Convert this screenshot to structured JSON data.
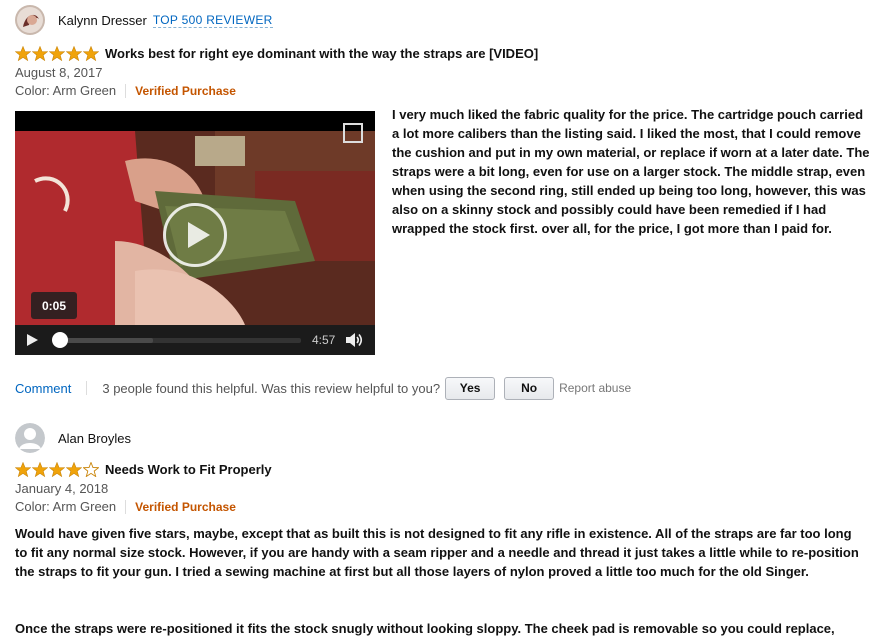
{
  "review1": {
    "reviewer": "Kalynn Dresser",
    "badge": "TOP 500 REVIEWER",
    "rating": 5,
    "title": "Works best for right eye dominant with the way the straps are [VIDEO]",
    "date": "August 8, 2017",
    "color": "Color: Arm Green",
    "verified": "Verified Purchase",
    "video": {
      "tooltip_time": "0:05",
      "duration": "4:57",
      "progress": 0.02,
      "buffered": 0.4
    },
    "body": " I very much liked the fabric quality for the price. The cartridge pouch carried a lot more calibers than the listing said. I liked the most, that I could remove the cushion and put in my own material, or replace if worn at a later date. The straps were a bit long, even for use on a larger stock. The middle strap, even when using the second ring, still ended up being too long, however, this was also on a skinny stock and possibly could have been remedied if I had wrapped the stock first. over all, for the price, I got more than I paid for.",
    "comment_label": "Comment",
    "helpful_text": "3 people found this helpful. Was this review helpful to you?",
    "yes_label": "Yes",
    "no_label": "No",
    "report_label": "Report abuse"
  },
  "review2": {
    "reviewer": "Alan Broyles",
    "rating": 4,
    "title": "Needs Work to Fit Properly",
    "date": "January 4, 2018",
    "color": "Color: Arm Green",
    "verified": "Verified Purchase",
    "body_p1": "Would have given five stars, maybe, except that as built this is not designed to fit any rifle in existence. All of the straps are far too long to fit any normal size stock. However, if you are handy with a seam ripper and a needle and thread it just takes a little while to re-position the straps to fit your gun. I tried a sewing machine at first but all those layers of nylon proved a little too much for the old Singer.",
    "body_p2": "Once the straps were re-positioned it fits the stock snugly without looking sloppy. The cheek pad is removable so you could replace,"
  },
  "colors": {
    "star": "#f0a30a",
    "link": "#0066c0",
    "verified": "#c45500"
  },
  "icons": [
    "star-filled-icon",
    "star-empty-icon",
    "expand-icon",
    "play-icon",
    "volume-icon",
    "avatar-placeholder-icon"
  ]
}
